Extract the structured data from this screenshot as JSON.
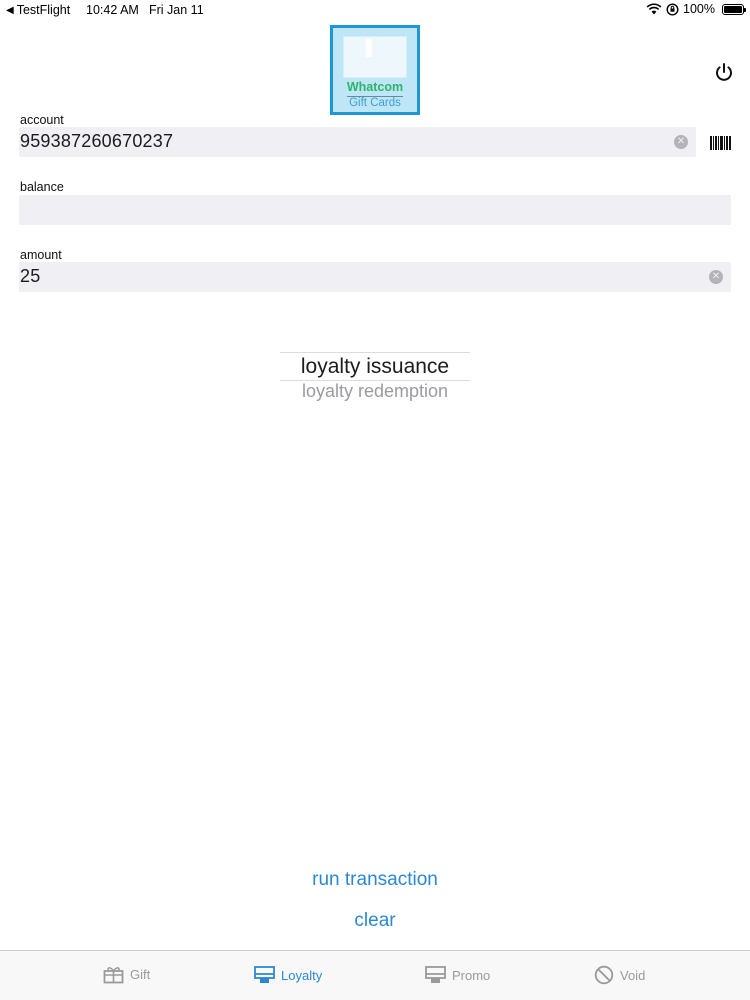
{
  "status_bar": {
    "back_app": "TestFlight",
    "time": "10:42 AM",
    "date": "Fri Jan 11",
    "battery": "100%",
    "battery_level": 1.0
  },
  "logo": {
    "title": "Whatcom",
    "subtitle": "Gift Cards"
  },
  "form": {
    "account": {
      "label": "account",
      "value": "959387260670237"
    },
    "balance": {
      "label": "balance",
      "value": ""
    },
    "amount": {
      "label": "amount",
      "value": "25"
    }
  },
  "picker": {
    "selected": "loyalty issuance",
    "next": "loyalty redemption"
  },
  "actions": {
    "run": "run transaction",
    "clear": "clear"
  },
  "tabs": [
    {
      "label": "Gift",
      "icon": "gift-icon",
      "active": false
    },
    {
      "label": "Loyalty",
      "icon": "card-icon",
      "active": true
    },
    {
      "label": "Promo",
      "icon": "card-icon",
      "active": false
    },
    {
      "label": "Void",
      "icon": "prohibited-icon",
      "active": false
    }
  ],
  "colors": {
    "accent": "#2d87d2",
    "field_bg": "#efeff4",
    "logo_border": "#1e97d6",
    "logo_title": "#2db36b"
  }
}
